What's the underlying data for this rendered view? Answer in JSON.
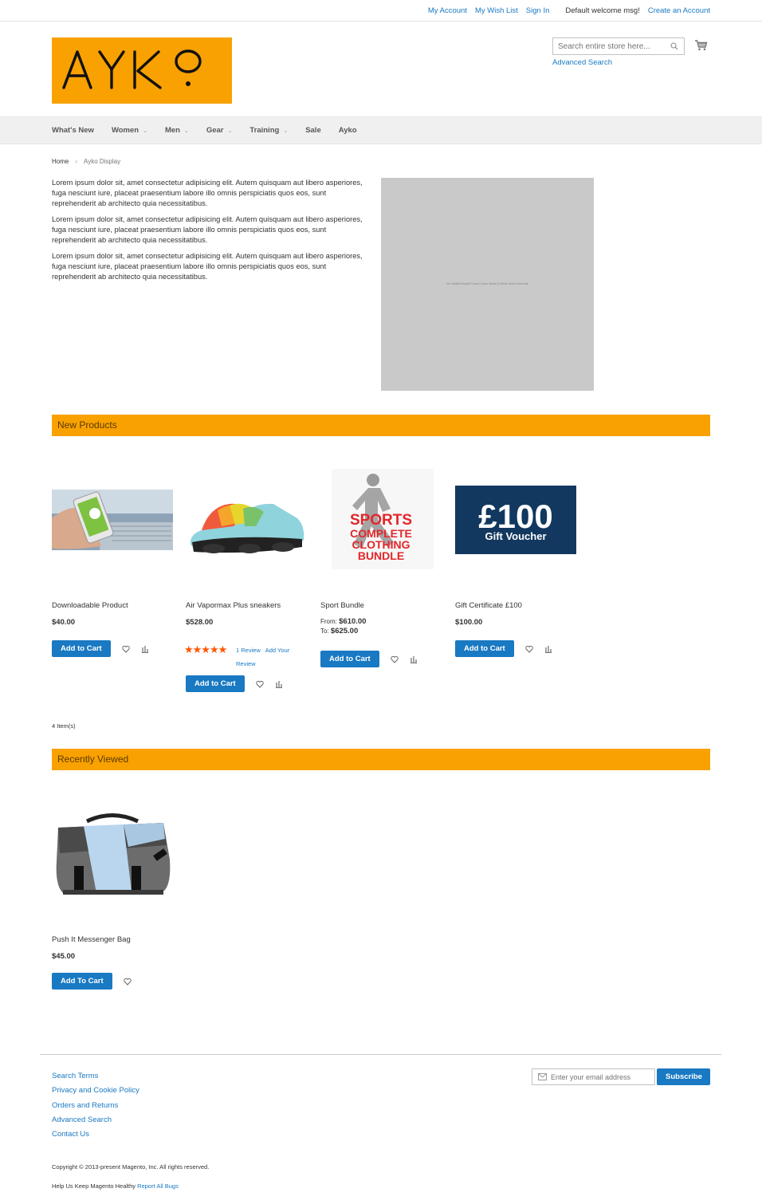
{
  "header": {
    "links": [
      "My Account",
      "My Wish List",
      "Sign In"
    ],
    "welcome": "Default welcome msg!",
    "create_account": "Create an Account",
    "logo_text": "AYKO",
    "search_placeholder": "Search entire store here...",
    "advanced_search": "Advanced Search"
  },
  "nav": {
    "items": [
      {
        "label": "What's New",
        "has_children": false
      },
      {
        "label": "Women",
        "has_children": true
      },
      {
        "label": "Men",
        "has_children": true
      },
      {
        "label": "Gear",
        "has_children": true
      },
      {
        "label": "Training",
        "has_children": true
      },
      {
        "label": "Sale",
        "has_children": false
      },
      {
        "label": "Ayko",
        "has_children": false
      }
    ]
  },
  "breadcrumb": {
    "home": "Home",
    "current": "Ayko Display"
  },
  "intro": {
    "paragraphs": [
      "Lorem ipsum dolor sit, amet consectetur adipisicing elit. Autem quisquam aut libero asperiores, fuga nesciunt iure, placeat praesentium labore illo omnis perspiciatis quos eos, sunt reprehenderit ab architecto quia necessitatibus.",
      "Lorem ipsum dolor sit, amet consectetur adipisicing elit. Autem quisquam aut libero asperiores, fuga nesciunt iure, placeat praesentium labore illo omnis perspiciatis quos eos, sunt reprehenderit ab architecto quia necessitatibus.",
      "Lorem ipsum dolor sit, amet consectetur adipisicing elit. Autem quisquam aut libero asperiores, fuga nesciunt iure, placeat praesentium labore illo omnis perspiciatis quos eos, sunt reprehenderit ab architecto quia necessitatibus."
    ],
    "placeholder_text": "No Width/Height Found If you Build A Wind view Informate"
  },
  "new_products": {
    "title": "New Products",
    "items": [
      {
        "name": "Downloadable Product",
        "price": "$40.00",
        "button": "Add to Cart"
      },
      {
        "name": "Air Vapormax Plus sneakers",
        "price": "$528.00",
        "button": "Add to Cart",
        "rating": "★★★★★",
        "reviews": "1  Review",
        "add_review": "Add Your Review"
      },
      {
        "name": "Sport Bundle",
        "price_from_label": "From:",
        "price_from": "$610.00",
        "price_to_label": "To:",
        "price_to": "$625.00",
        "button": "Add to Cart"
      },
      {
        "name": "Gift Certificate £100",
        "price": "$100.00",
        "button": "Add to Cart"
      }
    ],
    "count": "4 Item(s)"
  },
  "bundle_image": {
    "line1": "SPORTS",
    "line2": "COMPLETE",
    "line3": "CLOTHING",
    "line4": "BUNDLE"
  },
  "voucher_image": {
    "amount": "£100",
    "label": "Gift Voucher"
  },
  "recently_viewed": {
    "title": "Recently Viewed",
    "items": [
      {
        "name": "Push It Messenger Bag",
        "price": "$45.00",
        "button": "Add To Cart"
      }
    ]
  },
  "footer": {
    "links": [
      "Search Terms",
      "Privacy and Cookie Policy",
      "Orders and Returns",
      "Advanced Search",
      "Contact Us"
    ],
    "email_placeholder": "Enter your email address",
    "subscribe": "Subscribe",
    "copyright": "Copyright © 2013-present Magento, Inc. All rights reserved.",
    "bugs_text": "Help Us Keep Magento Healthy",
    "bugs_link": "Report All Bugs"
  },
  "colors": {
    "accent": "#f8a100",
    "link": "#1979c3",
    "button": "#1979c3",
    "rating": "#ff5501"
  }
}
